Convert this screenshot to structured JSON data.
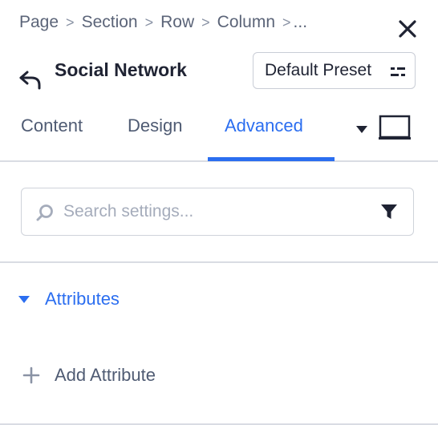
{
  "breadcrumb": {
    "items": [
      "Page",
      "Section",
      "Row",
      "Column"
    ],
    "overflow": "...",
    "separator": ">"
  },
  "header": {
    "title": "Social Network",
    "preset_label": "Default Preset"
  },
  "tabs": [
    {
      "label": "Content",
      "active": false
    },
    {
      "label": "Design",
      "active": false
    },
    {
      "label": "Advanced",
      "active": true
    }
  ],
  "search": {
    "placeholder": "Search settings...",
    "value": ""
  },
  "attributes_section": {
    "title": "Attributes",
    "expanded": true,
    "add_label": "Add Attribute"
  },
  "icons": {
    "close": "close-icon",
    "back": "back-arrow-icon",
    "preset": "preset-list-icon",
    "view_caret": "caret-down-icon",
    "view_toggle": "desktop-view-icon",
    "search": "search-icon",
    "filter": "filter-icon",
    "section_caret": "caret-down-icon",
    "add": "plus-icon"
  },
  "colors": {
    "accent": "#2b6ef0",
    "text_primary": "#1f2333",
    "text_secondary": "#4f5b73",
    "border": "#d9dce3"
  }
}
